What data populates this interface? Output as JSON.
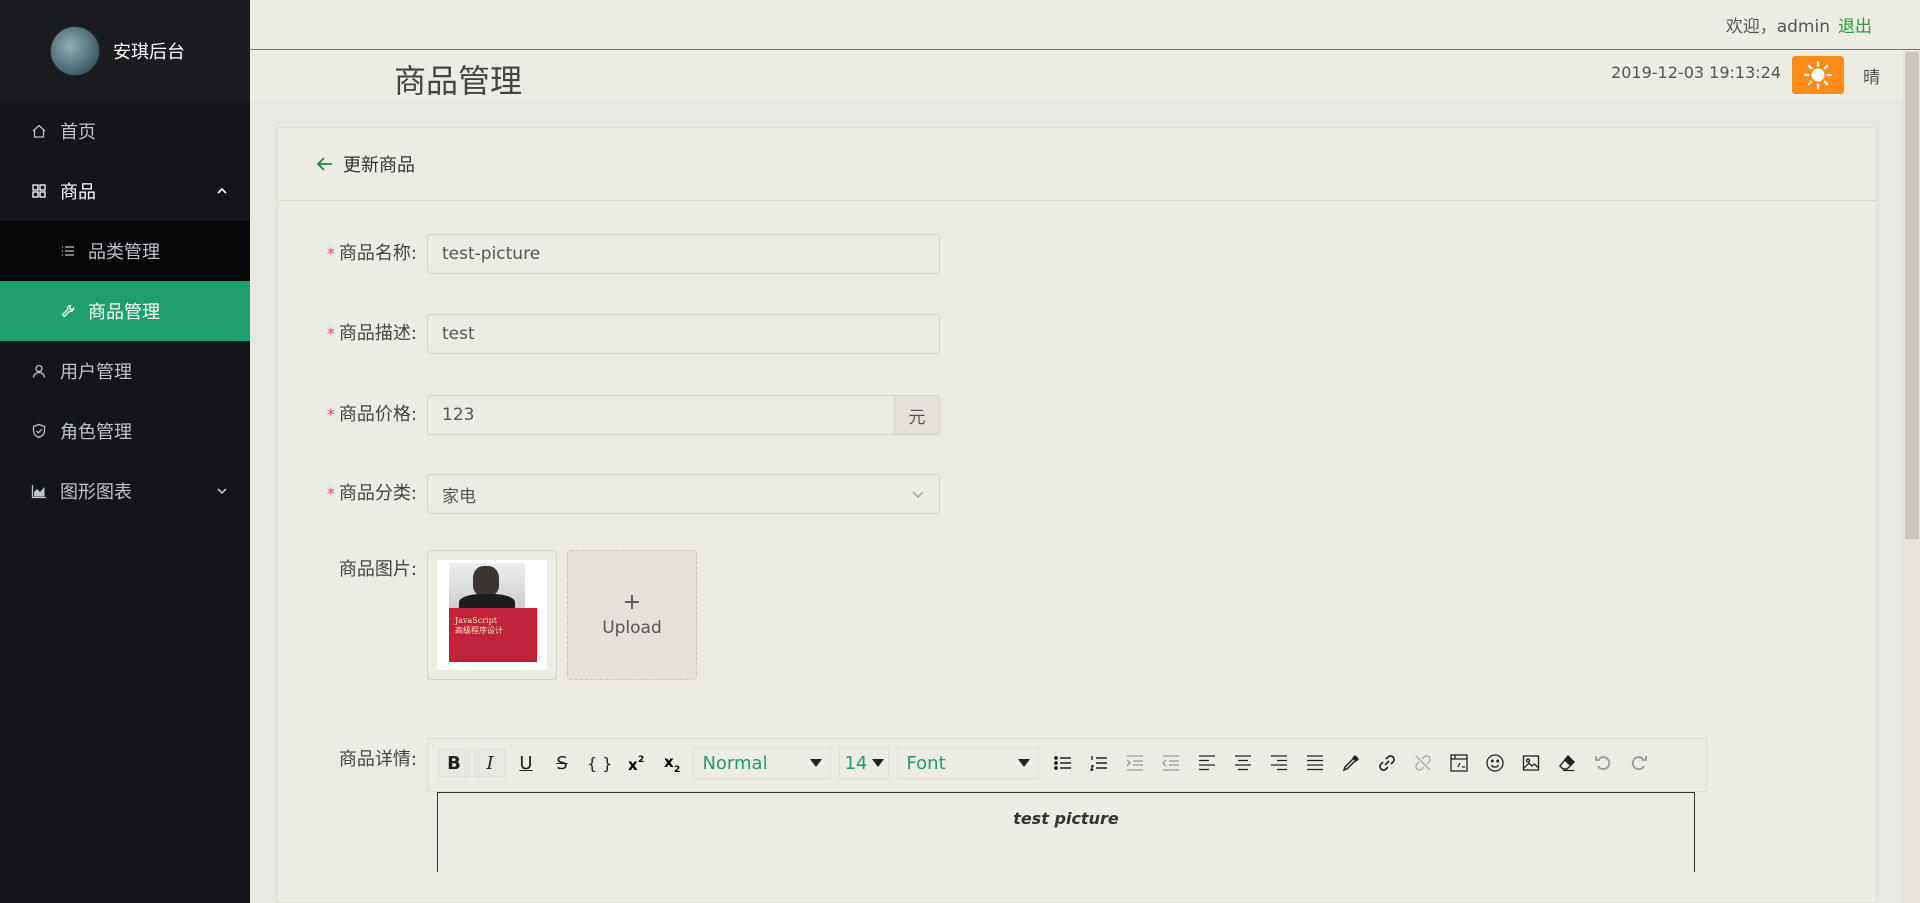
{
  "brand": {
    "name": "安琪后台"
  },
  "sidebar": {
    "items": [
      {
        "label": "首页",
        "icon": "home-icon"
      },
      {
        "label": "商品",
        "icon": "grid-icon",
        "expanded": true,
        "children": [
          {
            "label": "品类管理",
            "icon": "list-icon"
          },
          {
            "label": "商品管理",
            "icon": "wrench-icon",
            "active": true
          }
        ]
      },
      {
        "label": "用户管理",
        "icon": "user-icon"
      },
      {
        "label": "角色管理",
        "icon": "shield-icon"
      },
      {
        "label": "图形图表",
        "icon": "area-chart-icon"
      }
    ]
  },
  "header": {
    "welcome": "欢迎，admin",
    "logout": "退出",
    "title": "商品管理",
    "datetime": "2019-12-03 19:13:24",
    "weather_icon": "sun-icon",
    "weather": "晴"
  },
  "card": {
    "title": "更新商品",
    "fields": {
      "name": {
        "label": "商品名称:",
        "value": "test-picture",
        "required": true
      },
      "desc": {
        "label": "商品描述:",
        "value": "test",
        "required": true
      },
      "price": {
        "label": "商品价格:",
        "value": "123",
        "suffix": "元",
        "required": true
      },
      "category": {
        "label": "商品分类:",
        "value": "家电",
        "required": true
      },
      "images": {
        "label": "商品图片:",
        "upload_label": "Upload",
        "upload_plus": "+"
      },
      "detail": {
        "label": "商品详情:",
        "content": "test picture"
      }
    },
    "toolbar": {
      "heading": "Normal",
      "font_size": "14",
      "font": "Font",
      "bold": "B",
      "italic": "I",
      "underline": "U",
      "strike": "S",
      "code": "{ }"
    }
  },
  "colors": {
    "sidebar_bg": "#131518",
    "active": "#1f9e6e",
    "accent_green": "#20a040",
    "weather_orange": "#ff8c1a",
    "required": "#e5484d"
  }
}
